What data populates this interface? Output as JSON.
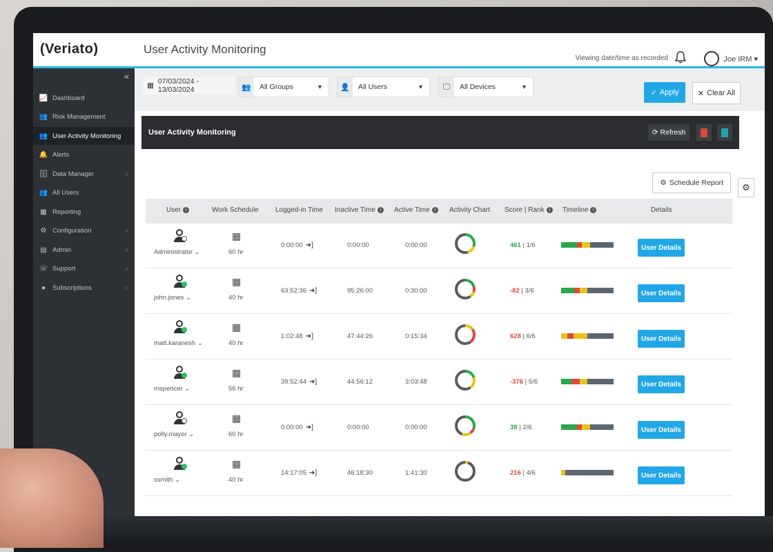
{
  "app": {
    "logo": "(Veriato)",
    "title": "User Activity Monitoring",
    "viewing_note": "Viewing date/time as recorded",
    "user_name": "Joe IRM ▾",
    "collapse": "«"
  },
  "sidebar": {
    "items": [
      {
        "label": "Dashboard",
        "icon": "chart-icon",
        "glyph": "📈"
      },
      {
        "label": "Risk Management",
        "icon": "users-warning-icon",
        "glyph": "👥"
      },
      {
        "label": "User Activity Monitoring",
        "icon": "user-activity-icon",
        "glyph": "👥",
        "active": true
      },
      {
        "label": "Alerts",
        "icon": "bell-icon",
        "glyph": "🔔"
      },
      {
        "label": "Data Manager",
        "icon": "database-icon",
        "glyph": "🗄",
        "chevron": true
      },
      {
        "label": "All Users",
        "icon": "all-users-icon",
        "glyph": "👥"
      },
      {
        "label": "Reporting",
        "icon": "table-icon",
        "glyph": "▦"
      },
      {
        "label": "Configuration",
        "icon": "gear-icon",
        "glyph": "⚙",
        "chevron": true
      },
      {
        "label": "Admin",
        "icon": "admin-icon",
        "glyph": "▤",
        "chevron": true
      },
      {
        "label": "Support",
        "icon": "support-icon",
        "glyph": "☏",
        "chevron": true
      },
      {
        "label": "Subscriptions",
        "icon": "subscriptions-icon",
        "glyph": "●",
        "chevron": true
      }
    ]
  },
  "filters": {
    "date_range": "07/03/2024 - 13/03/2024",
    "groups": "All Groups",
    "users": "All Users",
    "devices": "All Devices",
    "apply": "Apply",
    "clear": "Clear All"
  },
  "panel": {
    "title": "User Activity Monitoring",
    "refresh": "Refresh",
    "schedule_report": "Schedule Report"
  },
  "table": {
    "headers": {
      "user": "User",
      "work_schedule": "Work Schedule",
      "logged_in": "Logged-in Time",
      "inactive": "Inactive Time",
      "active": "Active Time",
      "activity_chart": "Activity Chart",
      "score_rank": "Score | Rank",
      "timeline": "Timeline",
      "details": "Details"
    },
    "details_label": "User Details",
    "rows": [
      {
        "user": "Administrator",
        "online": false,
        "schedule": "60 hr",
        "logged_in": "0:00:00",
        "inactive": "0:00:00",
        "active": "0:00:00",
        "score": "461",
        "score_positive": true,
        "rank": "1/6",
        "donut": [
          [
            "#2aa84a",
            0.3
          ],
          [
            "#e8c31a",
            0.15
          ],
          [
            "#555c63",
            0.55
          ]
        ],
        "timeline": [
          [
            "#2aa84a",
            0.3
          ],
          [
            "#e0483e",
            0.1
          ],
          [
            "#e8c31a",
            0.15
          ],
          [
            "#5d6670",
            0.45
          ]
        ]
      },
      {
        "user": "john.jones",
        "online": true,
        "schedule": "40 hr",
        "logged_in": "63:52:36",
        "inactive": "95:26:00",
        "active": "0:30:00",
        "score": "-82",
        "score_positive": false,
        "rank": "3/6",
        "donut": [
          [
            "#2aa84a",
            0.2
          ],
          [
            "#e0483e",
            0.1
          ],
          [
            "#e8c31a",
            0.1
          ],
          [
            "#555c63",
            0.6
          ]
        ],
        "timeline": [
          [
            "#2aa84a",
            0.25
          ],
          [
            "#e0483e",
            0.1
          ],
          [
            "#e8c31a",
            0.15
          ],
          [
            "#5d6670",
            0.5
          ]
        ]
      },
      {
        "user": "matt.karanesh",
        "online": true,
        "schedule": "40 hr",
        "logged_in": "1:02:48",
        "inactive": "47:44:26",
        "active": "0:15:34",
        "score": "628",
        "score_positive": false,
        "rank": "6/6",
        "donut": [
          [
            "#e8c31a",
            0.15
          ],
          [
            "#e0483e",
            0.25
          ],
          [
            "#555c63",
            0.6
          ]
        ],
        "timeline": [
          [
            "#e8c31a",
            0.12
          ],
          [
            "#e0483e",
            0.12
          ],
          [
            "#e8c31a",
            0.26
          ],
          [
            "#5d6670",
            0.5
          ]
        ]
      },
      {
        "user": "mspencer",
        "online": true,
        "schedule": "56 hr",
        "logged_in": "39:52:44",
        "inactive": "44:56:12",
        "active": "3:03:48",
        "score": "-376",
        "score_positive": false,
        "rank": "5/6",
        "donut": [
          [
            "#2aa84a",
            0.2
          ],
          [
            "#e8c31a",
            0.2
          ],
          [
            "#555c63",
            0.6
          ]
        ],
        "timeline": [
          [
            "#2aa84a",
            0.2
          ],
          [
            "#e0483e",
            0.15
          ],
          [
            "#e8c31a",
            0.15
          ],
          [
            "#5d6670",
            0.5
          ]
        ]
      },
      {
        "user": "polly.mayor",
        "online": false,
        "schedule": "60 hr",
        "logged_in": "0:00:00",
        "inactive": "0:00:00",
        "active": "0:00:00",
        "score": "38",
        "score_positive": true,
        "rank": "2/6",
        "donut": [
          [
            "#2aa84a",
            0.3
          ],
          [
            "#e0483e",
            0.1
          ],
          [
            "#e8c31a",
            0.15
          ],
          [
            "#555c63",
            0.45
          ]
        ],
        "timeline": [
          [
            "#2aa84a",
            0.3
          ],
          [
            "#e0483e",
            0.1
          ],
          [
            "#e8c31a",
            0.15
          ],
          [
            "#5d6670",
            0.45
          ]
        ]
      },
      {
        "user": "ssmith",
        "online": true,
        "schedule": "40 hr",
        "logged_in": "14:17:05",
        "inactive": "46:18:30",
        "active": "1:41:30",
        "score": "216",
        "score_positive": false,
        "rank": "4/6",
        "donut": [
          [
            "#e8c31a",
            0.05
          ],
          [
            "#555c63",
            0.95
          ]
        ],
        "timeline": [
          [
            "#e8c31a",
            0.08
          ],
          [
            "#5d6670",
            0.92
          ]
        ]
      }
    ]
  }
}
